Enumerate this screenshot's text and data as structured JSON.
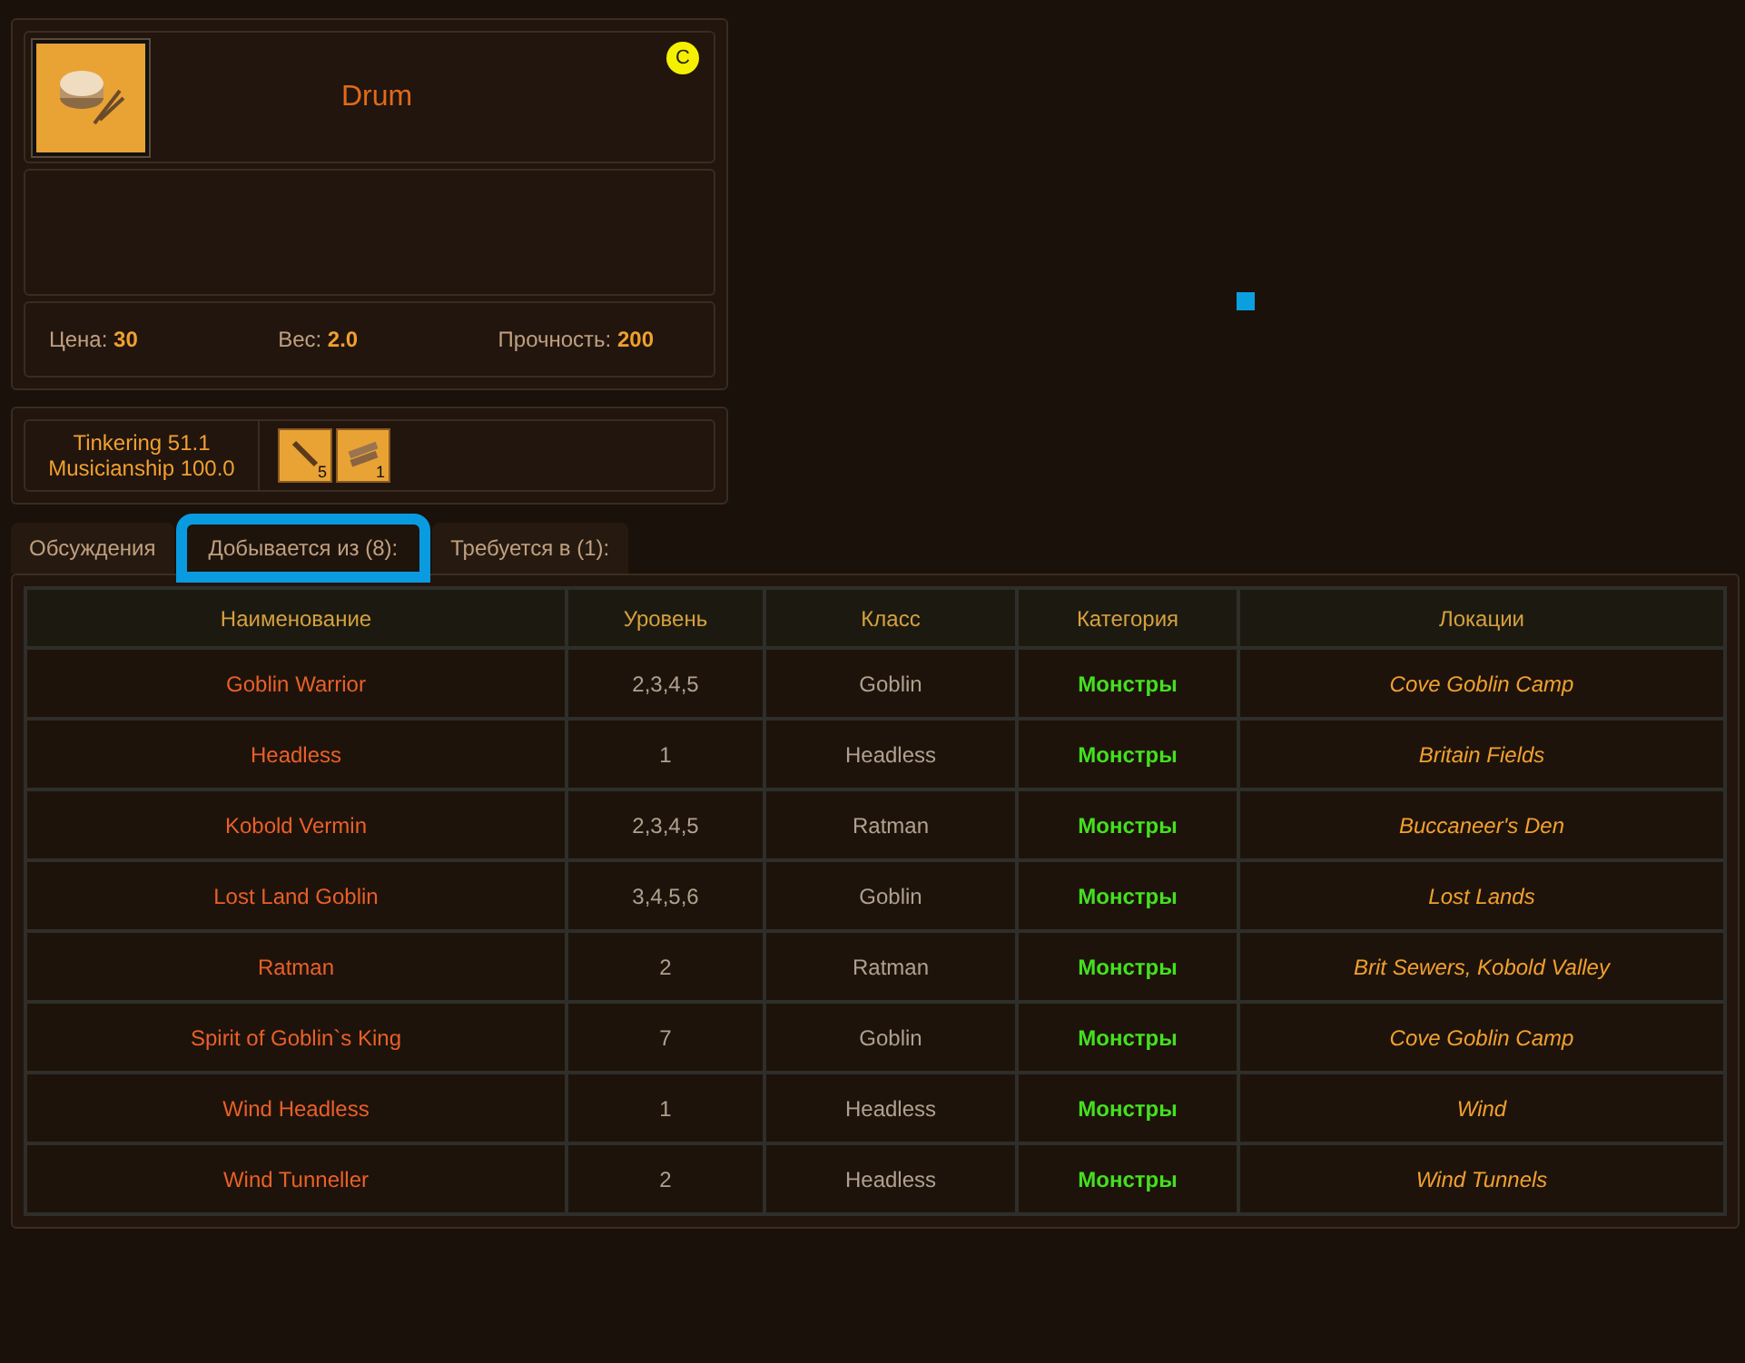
{
  "item": {
    "name": "Drum",
    "badge": "C",
    "stats": [
      {
        "label": "Цена:",
        "value": "30"
      },
      {
        "label": "Вес:",
        "value": "2.0"
      },
      {
        "label": "Прочность:",
        "value": "200"
      }
    ]
  },
  "requirements": {
    "skills": [
      "Tinkering 51.1",
      "Musicianship 100.0"
    ],
    "materials": [
      {
        "kind": "stick",
        "count": "5"
      },
      {
        "kind": "boards",
        "count": "1"
      }
    ]
  },
  "tabs": [
    {
      "label": "Обсуждения",
      "selected": false,
      "highlighted": false
    },
    {
      "label": "Добывается из (8):",
      "selected": true,
      "highlighted": true
    },
    {
      "label": "Требуется в (1):",
      "selected": false,
      "highlighted": false
    }
  ],
  "annotation_marker": true,
  "table": {
    "columns": [
      "Наименование",
      "Уровень",
      "Класс",
      "Категория",
      "Локации"
    ],
    "rows": [
      [
        "Goblin Warrior",
        "2,3,4,5",
        "Goblin",
        "Монстры",
        "Cove Goblin Camp"
      ],
      [
        "Headless",
        "1",
        "Headless",
        "Монстры",
        "Britain Fields"
      ],
      [
        "Kobold Vermin",
        "2,3,4,5",
        "Ratman",
        "Монстры",
        "Buccaneer's Den"
      ],
      [
        "Lost Land Goblin",
        "3,4,5,6",
        "Goblin",
        "Монстры",
        "Lost Lands"
      ],
      [
        "Ratman",
        "2",
        "Ratman",
        "Монстры",
        "Brit Sewers, Kobold Valley"
      ],
      [
        "Spirit of Goblin`s King",
        "7",
        "Goblin",
        "Монстры",
        "Cove Goblin Camp"
      ],
      [
        "Wind Headless",
        "1",
        "Headless",
        "Монстры",
        "Wind"
      ],
      [
        "Wind Tunneller",
        "2",
        "Headless",
        "Монстры",
        "Wind Tunnels"
      ]
    ]
  }
}
